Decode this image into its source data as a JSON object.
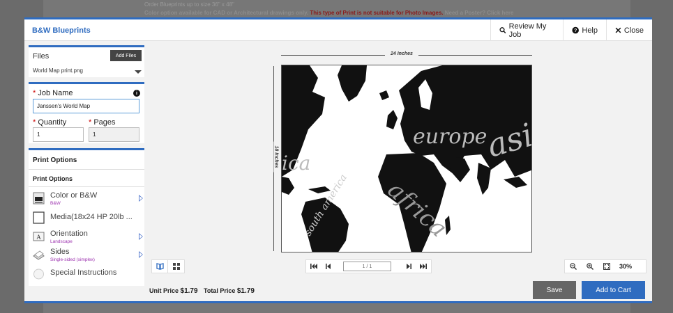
{
  "background": {
    "note_line1": "Order Blueprints up to size 36\" x 48\"",
    "note_line2_a": "Color option available for CAD or Architectural drawings only.",
    "note_line2_b": "This type of Print is not suitable for Photo Images.",
    "note_line2_c": "Need a Poster? Click here"
  },
  "header": {
    "title": "B&W Blueprints",
    "review_label": "Review My Job",
    "help_label": "Help",
    "close_label": "Close"
  },
  "files": {
    "label": "Files",
    "add_label": "Add Files",
    "selected_file": "World Map print.png"
  },
  "job": {
    "name_label": "Job Name",
    "name_value": "Janssen's World Map",
    "quantity_label": "Quantity",
    "quantity_value": "1",
    "pages_label": "Pages",
    "pages_value": "1",
    "required_mark": "*"
  },
  "print_options": {
    "heading": "Print Options",
    "subheading": "Print Options",
    "items": [
      {
        "label": "Color or B&W",
        "value": "B&W"
      },
      {
        "label": "Media(18x24 HP 20lb ...",
        "value": ""
      },
      {
        "label": "Orientation",
        "value": "Landscape"
      },
      {
        "label": "Sides",
        "value": "Single-sided (simplex)"
      },
      {
        "label": "Special Instructions",
        "value": ""
      }
    ]
  },
  "preview": {
    "width_label": "24 Inches",
    "height_label": "18 Inches",
    "map_words": [
      "europe",
      "asi",
      "africa",
      "ica",
      "south america"
    ]
  },
  "pager": {
    "page_value": "1 / 1"
  },
  "zoom": {
    "value": "30%"
  },
  "footer": {
    "unit_label": "Unit Price",
    "unit_value": "$1.79",
    "total_label": "Total Price",
    "total_value": "$1.79",
    "save_label": "Save",
    "cart_label": "Add to Cart"
  },
  "colors": {
    "accent": "#2f6cc0",
    "option_value": "#9b2fae"
  }
}
